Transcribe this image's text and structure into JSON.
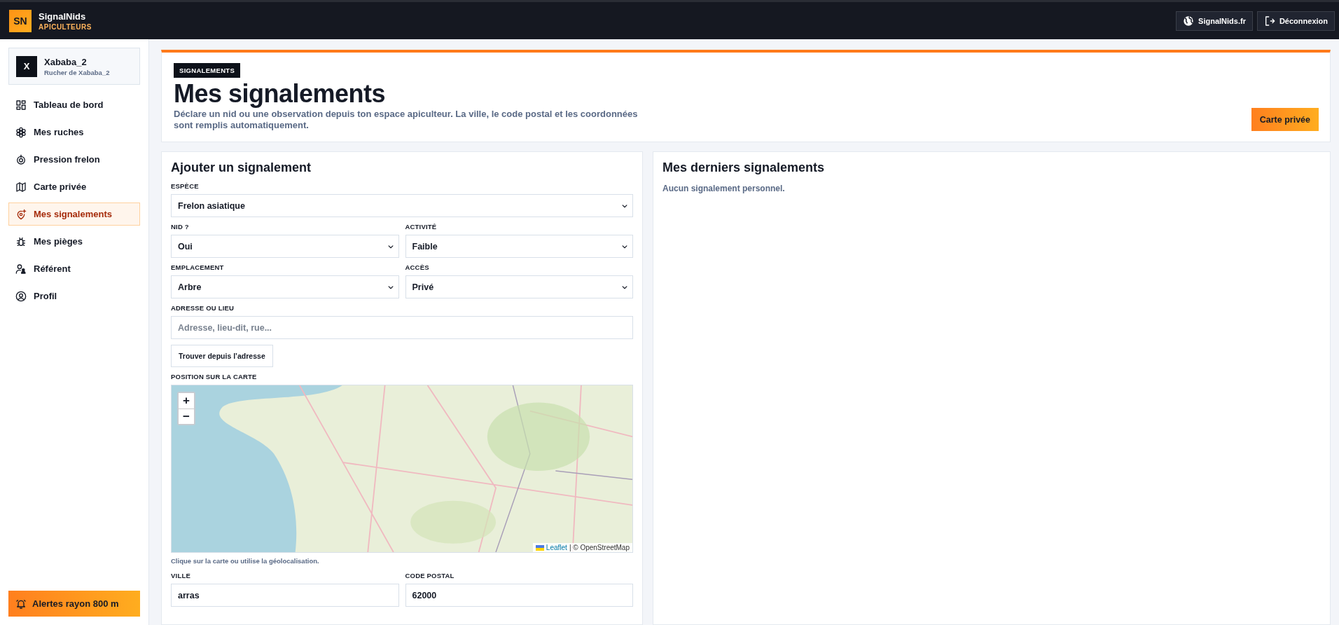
{
  "topbar": {
    "logo": "SN",
    "brand": "SignalNids",
    "subtitle": "APICULTEURS",
    "actions": [
      {
        "kind": "website",
        "label": "SignalNids.fr"
      },
      {
        "kind": "logout",
        "label": "Déconnexion"
      }
    ]
  },
  "sidebar": {
    "user": {
      "initial": "X",
      "name": "Xababa_2",
      "apiary": "Rucher de Xababa_2"
    },
    "items": [
      {
        "kind": "dashboard",
        "label": "Tableau de bord",
        "selected": false
      },
      {
        "kind": "hives",
        "label": "Mes ruches",
        "selected": false
      },
      {
        "kind": "pressure",
        "label": "Pression frelon",
        "selected": false
      },
      {
        "kind": "map",
        "label": "Carte privée",
        "selected": false
      },
      {
        "kind": "reports",
        "label": "Mes signalements",
        "selected": true
      },
      {
        "kind": "traps",
        "label": "Mes pièges",
        "selected": false
      },
      {
        "kind": "referent",
        "label": "Référent",
        "selected": false
      },
      {
        "kind": "profile",
        "label": "Profil",
        "selected": false
      }
    ],
    "alert_button": "Alertes rayon 800 m"
  },
  "header": {
    "tag": "SIGNALEMENTS",
    "title": "Mes signalements",
    "description": "Déclare un nid ou une observation depuis ton espace apiculteur. La ville, le code postal et les coordonnées sont remplis automatiquement.",
    "button": "Carte privée"
  },
  "form": {
    "title": "Ajouter un signalement",
    "sections": [
      {
        "kind": "row",
        "fields": [
          {
            "kind": "select",
            "label": "ESPÈCE",
            "value": "Frelon asiatique"
          }
        ]
      },
      {
        "kind": "row",
        "fields": [
          {
            "kind": "select",
            "label": "NID ?",
            "value": "Oui"
          },
          {
            "kind": "select",
            "label": "ACTIVITÉ",
            "value": "Faible"
          }
        ]
      },
      {
        "kind": "row",
        "fields": [
          {
            "kind": "select",
            "label": "EMPLACEMENT",
            "value": "Arbre"
          },
          {
            "kind": "select",
            "label": "ACCÈS",
            "value": "Privé"
          }
        ]
      },
      {
        "kind": "row",
        "fields": [
          {
            "kind": "input",
            "label": "ADRESSE OU LIEU",
            "placeholder": "Adresse, lieu-dit, rue..."
          }
        ]
      },
      {
        "kind": "button",
        "label": "Trouver depuis l’adresse"
      },
      {
        "kind": "map",
        "label": "POSITION SUR LA CARTE",
        "zoom_in": "+",
        "zoom_out": "−",
        "attribution_link": "Leaflet",
        "attribution": "| © OpenStreetMap"
      },
      {
        "kind": "hint",
        "text": "Clique sur la carte ou utilise la géolocalisation."
      },
      {
        "kind": "row",
        "fields": [
          {
            "kind": "input",
            "label": "VILLE",
            "value": "arras"
          },
          {
            "kind": "input",
            "label": "CODE POSTAL",
            "value": "62000"
          }
        ]
      }
    ]
  },
  "recent": {
    "title": "Mes derniers signalements",
    "empty": "Aucun signalement personnel."
  }
}
